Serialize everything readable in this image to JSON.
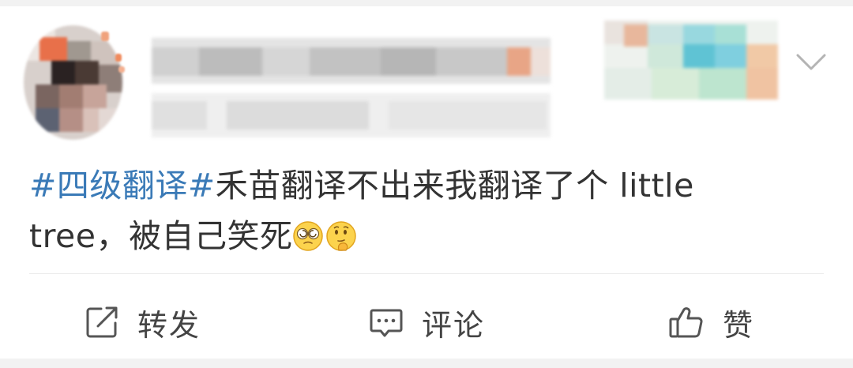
{
  "header": {
    "avatar": "avatar-pixelated",
    "username": "",
    "meta": "",
    "menu_icon": "chevron-down-icon"
  },
  "post": {
    "topic": "#四级翻译#",
    "body_line1": "禾苗翻译不出来我翻译了个 little",
    "body_line2": "tree，被自己笑死",
    "emojis": [
      "dizzy-face-emoji",
      "thinking-face-emoji"
    ]
  },
  "actions": {
    "repost_icon": "share-icon",
    "repost_label": "转发",
    "comment_icon": "comment-icon",
    "comment_label": "评论",
    "like_icon": "thumbs-up-icon",
    "like_label": "赞"
  },
  "colors": {
    "topic_link": "#3a7ab7",
    "text": "#333333",
    "action_text": "#444444",
    "divider": "#ececec",
    "page_bg": "#f2f2f2",
    "card_bg": "#ffffff"
  }
}
